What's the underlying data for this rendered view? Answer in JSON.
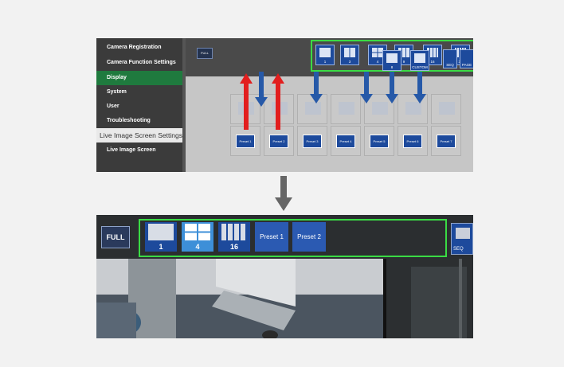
{
  "sidebar": {
    "items": [
      {
        "label": "Camera Registration",
        "state": "normal"
      },
      {
        "label": "Camera Function Settings",
        "state": "normal"
      },
      {
        "label": "Display",
        "state": "active"
      },
      {
        "label": "System",
        "state": "normal"
      },
      {
        "label": "User",
        "state": "normal"
      },
      {
        "label": "Troubleshooting",
        "state": "normal"
      },
      {
        "label": "Live Image Screen Settings",
        "state": "sub"
      },
      {
        "label": "Live Image Screen",
        "state": "normal"
      }
    ]
  },
  "top_toolbar": {
    "full_label": "FULL",
    "layout_buttons": [
      "1",
      "3",
      "4",
      "9",
      "16",
      "32",
      "8",
      "CUSTOM"
    ],
    "right_buttons": [
      "SEQ",
      "PAGE"
    ]
  },
  "top_presets": [
    "Preset 1",
    "Preset 2",
    "Preset 3",
    "Preset 4",
    "Preset 5",
    "Preset 6",
    "Preset 7"
  ],
  "bottom_toolbar": {
    "full_label": "FULL",
    "layout_buttons": [
      {
        "label": "1",
        "selected": false
      },
      {
        "label": "4",
        "selected": true
      },
      {
        "label": "16",
        "selected": false
      }
    ],
    "presets": [
      "Preset 1",
      "Preset 2"
    ],
    "right_label": "SEQ"
  },
  "colors": {
    "highlight_box": "#3adb44",
    "button_blue": "#1d4a9c",
    "selected_blue": "#3d8fd8",
    "arrow_red": "#e21e1e",
    "arrow_blue": "#2659a8",
    "sidebar_active": "#1f7a3e"
  }
}
